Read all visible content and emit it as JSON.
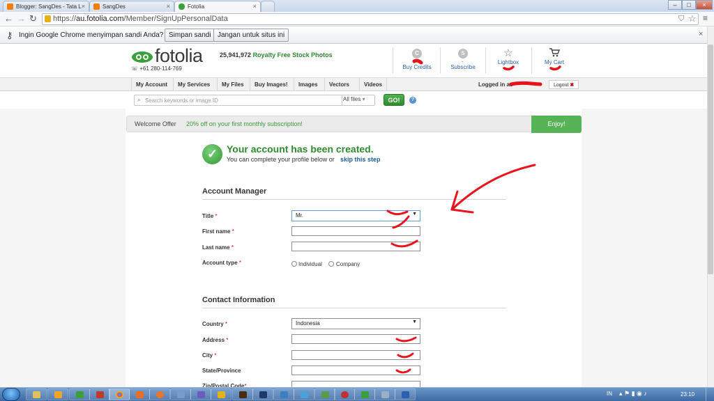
{
  "browser": {
    "tabs": [
      {
        "label": "Blogger: SangDes - Tata L",
        "icon_color": "#f57d00"
      },
      {
        "label": "SangDes",
        "icon_color": "#f57d00"
      },
      {
        "label": "Fotolia",
        "icon_color": "#3aa03a",
        "active": true
      }
    ],
    "url_prefix": "https://",
    "url_host": "au.fotolia.com",
    "url_path": "/Member/SignUpPersonalData",
    "infobar": {
      "message": "Ingin Google Chrome menyimpan sandi Anda?",
      "save_label": "Simpan sandi",
      "never_label": "Jangan untuk situs ini"
    }
  },
  "header": {
    "logo_text": "fotolia",
    "phone": "+61 280-114-769",
    "count": "25,941,972",
    "tagline": "Royalty Free Stock Photos",
    "links": [
      {
        "label": "Buy Credits",
        "icon": "C"
      },
      {
        "label": "Subscribe",
        "icon": "S"
      },
      {
        "label": "Lightbox",
        "icon": "star"
      },
      {
        "label": "My Cart",
        "icon": "cart"
      }
    ]
  },
  "nav": {
    "items": [
      "My Account",
      "My Services",
      "My Files",
      "Buy Images!",
      "Images",
      "Vectors",
      "Videos"
    ],
    "logged_in_as": "Logged in as",
    "logout": "Logout"
  },
  "search": {
    "placeholder": "Search keywords or image ID",
    "filter": "All files",
    "go": "GO!",
    "help": "?"
  },
  "offer": {
    "label": "Welcome Offer",
    "text": "20% off on your first monthly subscription!",
    "button": "Enjoy!"
  },
  "success": {
    "title": "Your account has been created.",
    "subtitle": "You can complete your profile below or",
    "skip": "skip this step"
  },
  "account": {
    "section_title": "Account Manager",
    "title_label": "Title",
    "title_value": "Mr.",
    "first_name_label": "First name",
    "last_name_label": "Last name",
    "account_type_label": "Account type",
    "type_individual": "Individual",
    "type_company": "Company"
  },
  "contact": {
    "section_title": "Contact Information",
    "country_label": "Country",
    "country_value": "Indonesia",
    "address_label": "Address",
    "city_label": "City",
    "state_label": "State/Province",
    "zip_label": "Zip/Postal Code"
  },
  "taskbar": {
    "ime": "IN",
    "clock": "23:10"
  },
  "colors": {
    "brand_green": "#2f8a2f",
    "annotation_red": "#e8131b",
    "link_blue": "#1f5f9f"
  }
}
